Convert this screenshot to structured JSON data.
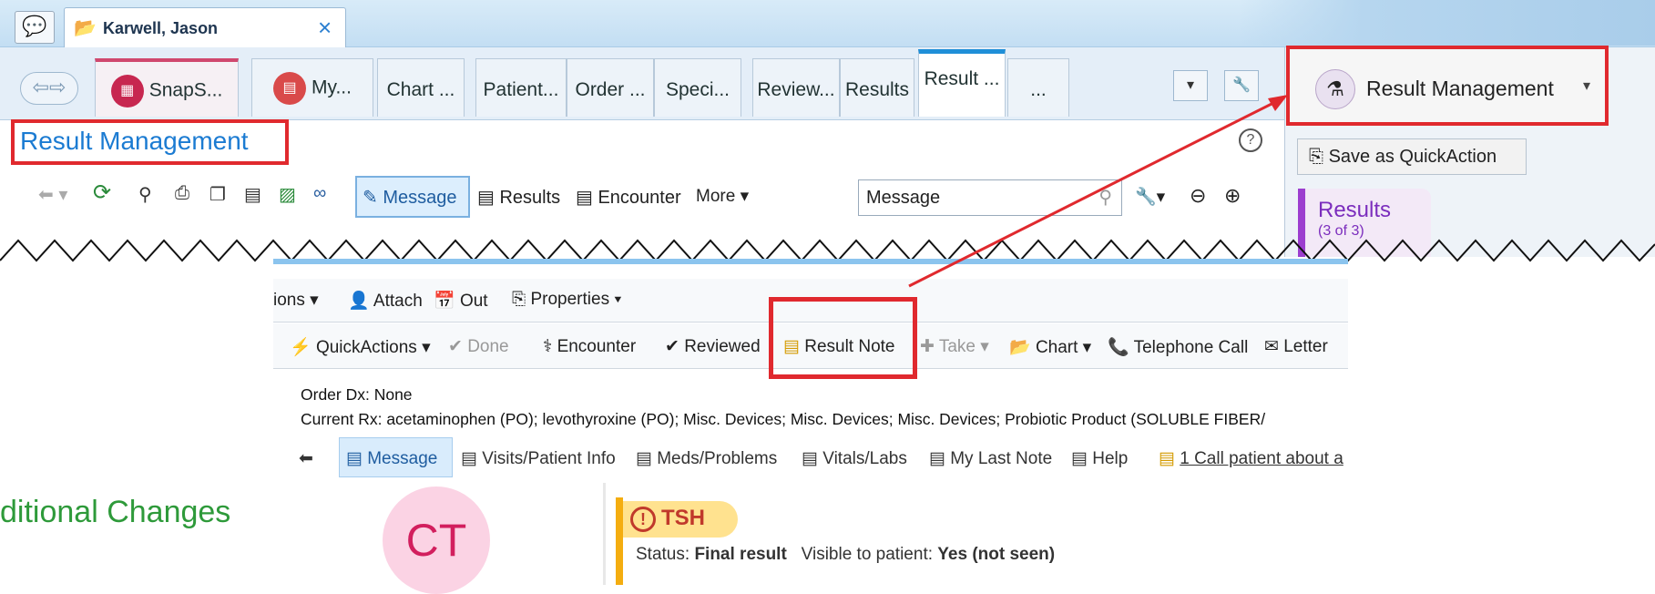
{
  "window": {
    "patient_tab": "Karwell, Jason"
  },
  "nav_tabs": [
    "SnapS...",
    "My...",
    "Chart ...",
    "Patient...",
    "Order ...",
    "Speci...",
    "Review...",
    "Results",
    "Result ...",
    "..."
  ],
  "page": {
    "title": "Result Management",
    "help": "?"
  },
  "toolbar": {
    "message": "Message",
    "results": "Results",
    "encounter": "Encounter",
    "more": "More ▾",
    "search_value": "Message"
  },
  "right_panel": {
    "activity": "Result Management",
    "quick_action": "Save as QuickAction",
    "results_title": "Results",
    "results_count": "(3 of 3)"
  },
  "actions_bar1": {
    "options": "ions ▾",
    "attach": "Attach",
    "out": "Out",
    "properties": "Properties ▾"
  },
  "actions_bar2": {
    "quickactions": "QuickActions ▾",
    "done": "Done",
    "encounter": "Encounter",
    "reviewed": "Reviewed",
    "result_note": "Result Note",
    "take": "Take ▾",
    "chart": "Chart ▾",
    "telephone": "Telephone Call",
    "letter": "Letter"
  },
  "order": {
    "dx": "Order Dx: None",
    "rx": "Current Rx: acetaminophen (PO); levothyroxine (PO); Misc. Devices; Misc. Devices; Misc. Devices; Probiotic Product (SOLUBLE FIBER/"
  },
  "subtabs": {
    "message": "Message",
    "visits": "Visits/Patient Info",
    "meds": "Meds/Problems",
    "vitals": "Vitals/Labs",
    "last_note": "My Last Note",
    "help": "Help",
    "call": "1 Call patient about a"
  },
  "avatar_initials": "CT",
  "result": {
    "name": "TSH",
    "status_label": "Status:",
    "status_value": "Final result",
    "visible_label": "Visible to patient:",
    "visible_value": "Yes (not seen)"
  },
  "caption": "ditional Changes",
  "colors": {
    "highlight": "#e0292e",
    "accent": "#1f8fd8",
    "caption": "#2e9a3a"
  }
}
